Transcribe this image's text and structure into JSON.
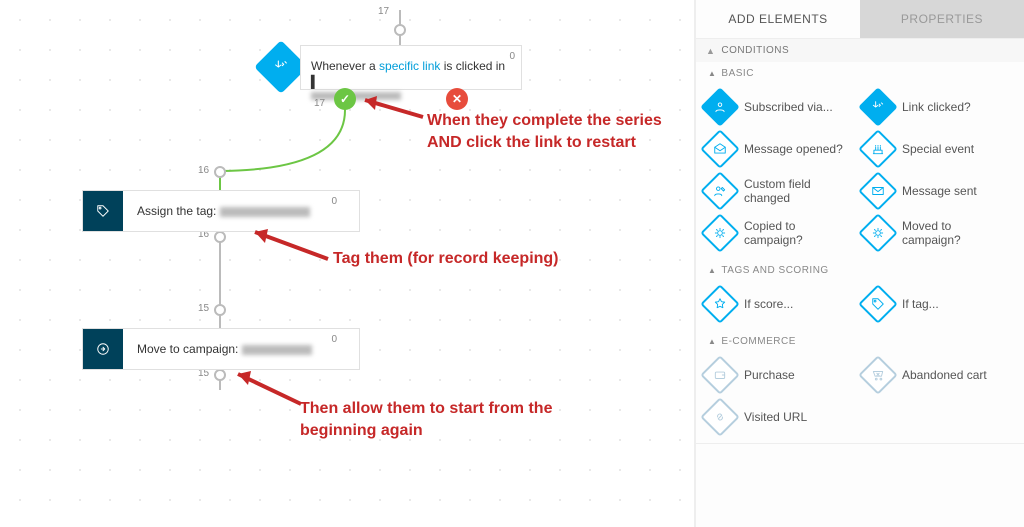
{
  "counts": {
    "top_in": "17",
    "card1_right": "0",
    "branch_ok": "17",
    "card2_in": "16",
    "card2_right": "0",
    "card3_in_a": "16",
    "card3_in_b": "15",
    "card3_right": "0",
    "card3_out": "15"
  },
  "cards": {
    "c1_prefix": "Whenever a ",
    "c1_link": "specific link",
    "c1_suffix": " is clicked in ",
    "c2_text": "Assign the tag: ",
    "c3_text": "Move to campaign: "
  },
  "annotations": {
    "a1": "When they complete the series AND click the link to restart",
    "a2": "Tag them (for record keeping)",
    "a3": "Then allow them to start from the beginning again"
  },
  "panel": {
    "tab1": "ADD ELEMENTS",
    "tab2": "PROPERTIES",
    "sect_conditions": "CONDITIONS",
    "group_basic": "BASIC",
    "group_tags": "TAGS AND SCORING",
    "group_ecom": "E-COMMERCE",
    "tiles": {
      "sub_via": "Subscribed via...",
      "link_clicked": "Link clicked?",
      "msg_opened": "Message opened?",
      "special_event": "Special event",
      "field_changed": "Custom field changed",
      "msg_sent": "Message sent",
      "copied": "Copied to campaign?",
      "moved": "Moved to campaign?",
      "if_score": "If score...",
      "if_tag": "If tag...",
      "purchase": "Purchase",
      "abandoned": "Abandoned cart",
      "visited": "Visited URL"
    }
  }
}
